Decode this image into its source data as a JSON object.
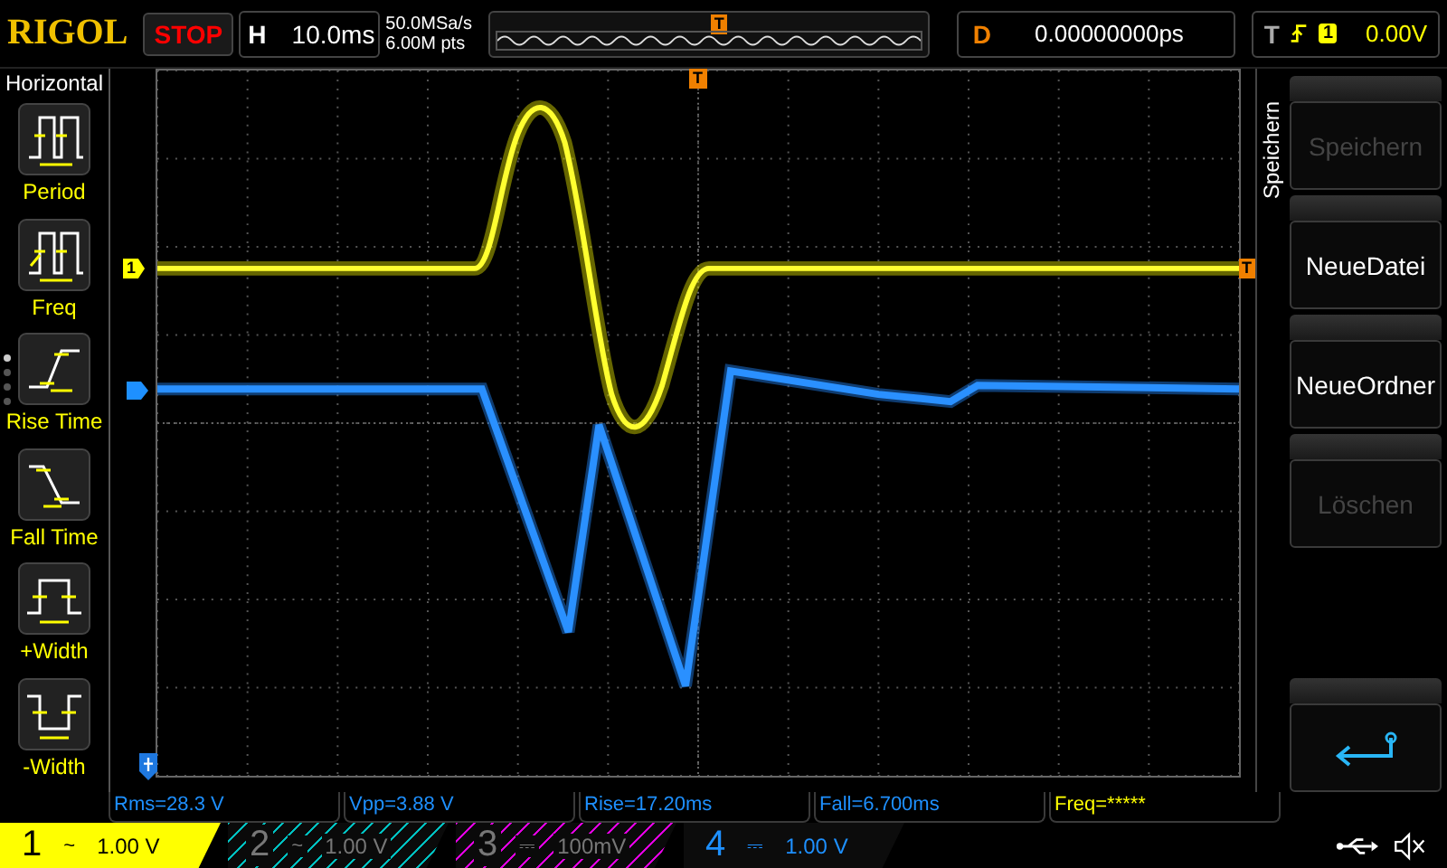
{
  "header": {
    "brand": "RIGOL",
    "run_state": "STOP",
    "timebase": {
      "label": "H",
      "value": "10.0ms"
    },
    "sample_rate": "50.0MSa/s",
    "memory_depth": "6.00M pts",
    "memory_trigger": "T",
    "delay": {
      "label": "D",
      "value": "0.00000000ps"
    },
    "trigger": {
      "label": "T",
      "source": "1",
      "level": "0.00V"
    }
  },
  "left_menu": {
    "title": "Horizontal",
    "items": [
      {
        "kind": "period",
        "label": "Period"
      },
      {
        "kind": "freq",
        "label": "Freq"
      },
      {
        "kind": "rise",
        "label": "Rise Time"
      },
      {
        "kind": "fall",
        "label": "Fall Time"
      },
      {
        "kind": "pwidth",
        "label": "+Width"
      },
      {
        "kind": "nwidth",
        "label": "-Width"
      }
    ],
    "pages": [
      {
        "selected": true
      },
      {
        "selected": false
      },
      {
        "selected": false
      },
      {
        "selected": false
      }
    ]
  },
  "screen": {
    "trigger_position": "T",
    "trigger_level": "T",
    "channel_marker": "1"
  },
  "right_menu": {
    "title": "Speichern",
    "buttons": [
      {
        "kind": "text",
        "label": "Speichern",
        "disabled": true
      },
      {
        "kind": "text",
        "label": "NeueDatei",
        "disabled": false
      },
      {
        "kind": "text",
        "label": "NeueOrdner",
        "disabled": false
      },
      {
        "kind": "text",
        "label": "Löschen",
        "disabled": true
      },
      {
        "kind": "back"
      }
    ]
  },
  "measurements": [
    {
      "text": "Rms=28.3 V",
      "color": "#1e90ff"
    },
    {
      "text": "Vpp=3.88 V",
      "color": "#1e90ff"
    },
    {
      "text": "Rise=17.20ms",
      "color": "#1e90ff"
    },
    {
      "text": "Fall=6.700ms",
      "color": "#1e90ff"
    },
    {
      "text": "Freq=*****",
      "color": "#ffff00"
    }
  ],
  "channels": [
    {
      "number": "1",
      "coupling": "~",
      "scale": "1.00 V",
      "on": true,
      "selected": true,
      "color": "#ffff00"
    },
    {
      "number": "2",
      "coupling": "~",
      "scale": "1.00 V",
      "on": false,
      "selected": false,
      "color": "#00c0c0"
    },
    {
      "number": "3",
      "coupling": "⎓",
      "scale": "100mV",
      "on": false,
      "selected": false,
      "color": "#e000e0"
    },
    {
      "number": "4",
      "coupling": "⎓",
      "scale": "1.00 V",
      "on": true,
      "selected": false,
      "color": "#1e90ff"
    }
  ]
}
